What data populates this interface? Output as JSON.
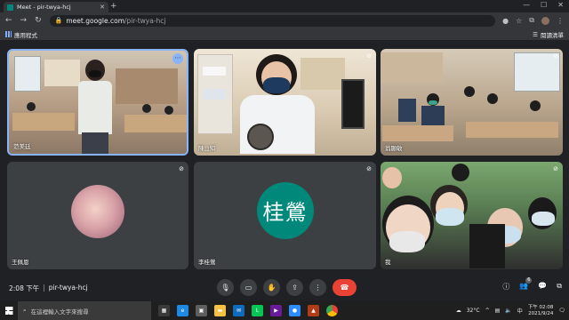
{
  "browser": {
    "tab_title": "Meet - pir-twya-hcj",
    "tab_close": "✕",
    "new_tab": "+",
    "url_host": "meet.google.com",
    "url_path": "/pir-twya-hcj",
    "bookmarks_apps": "應用程式",
    "reading_list": "閱讀清單"
  },
  "participants": [
    {
      "name": "范美廷",
      "mic": "on"
    },
    {
      "name": "陳□知",
      "mic": "muted"
    },
    {
      "name": "翁顯敏",
      "mic": "muted"
    },
    {
      "name": "王佩恩",
      "mic": "muted"
    },
    {
      "name": "李桂鶯",
      "initials": "桂鶯",
      "mic": "muted"
    },
    {
      "name": "我",
      "mic": "muted"
    }
  ],
  "toolbar": {
    "time": "2:08 下午",
    "separator": "|",
    "meeting_code": "pir-twya-hcj",
    "people_count": "6"
  },
  "taskbar": {
    "search_placeholder": "在這裡輸入文字來搜尋",
    "temperature": "32°C",
    "ime": "中",
    "clock_time": "下午 02:08",
    "clock_date": "2021/9/24"
  },
  "colors": {
    "accent": "#8ab4f8",
    "end_call": "#ea4335",
    "avatar_teal": "#00897b"
  }
}
